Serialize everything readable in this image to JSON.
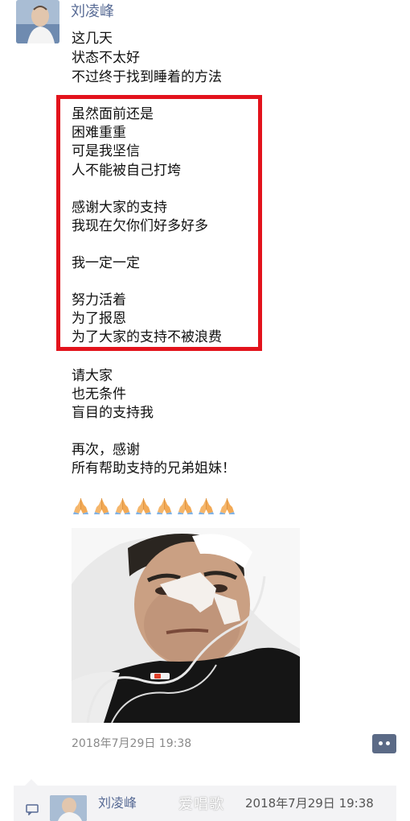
{
  "post": {
    "author": "刘凌峰",
    "text_lines": [
      "这几天",
      "状态不太好",
      "不过终于找到睡着的方法",
      "虽然面前还是",
      "困难重重",
      "可是我坚信",
      "人不能被自己打垮",
      "感谢大家的支持",
      "我现在欠你们好多好多",
      "我一定一定",
      "努力活着",
      "为了报恩",
      "为了大家的支持不被浪费",
      "请大家",
      "也无条件",
      "盲目的支持我",
      "再次，感谢",
      "所有帮助支持的兄弟姐妹！"
    ],
    "emoji_count": 8,
    "emoji_name": "folded-hands",
    "timestamp": "2018年7月29日 19:38"
  },
  "comment_bar": {
    "author": "刘凌峰",
    "timestamp": "2018年7月29日 19:38"
  },
  "watermark": "爱唱歌",
  "colors": {
    "name": "#586b95",
    "highlight_border": "#e3131c",
    "timestamp": "#8a8a8a",
    "comment_button": "#5b6a86",
    "comment_bg": "#f3f3f5"
  }
}
